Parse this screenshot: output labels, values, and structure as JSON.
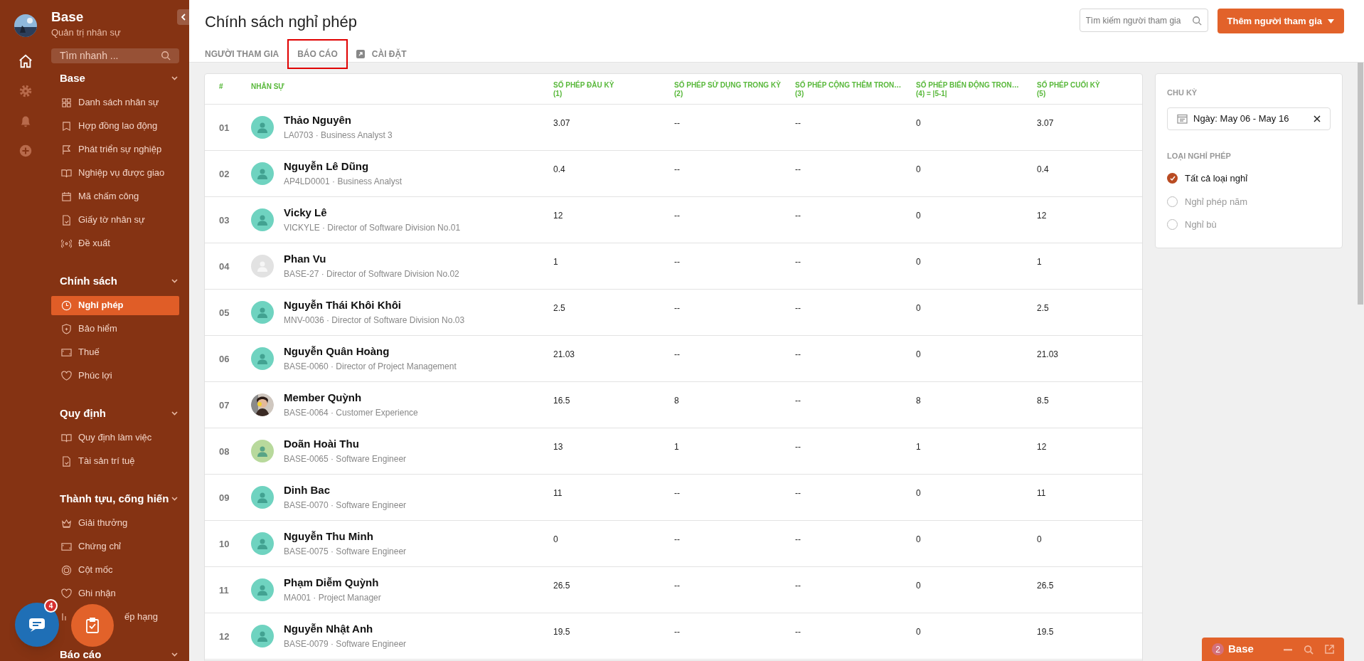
{
  "app": {
    "title": "Base",
    "subtitle": "Quản trị nhân sự",
    "search_placeholder": "Tìm nhanh ..."
  },
  "rail": [
    {
      "selected": true
    },
    {
      "selected": false
    },
    {
      "selected": false
    },
    {
      "selected": false
    }
  ],
  "sidebar": [
    {
      "heading": "Base",
      "items": [
        {
          "label": "Danh sách nhân sự",
          "selected": false
        },
        {
          "label": "Hợp đồng lao động",
          "selected": false
        },
        {
          "label": "Phát triển sự nghiệp",
          "selected": false
        },
        {
          "label": "Nghiệp vụ được giao",
          "selected": false
        },
        {
          "label": "Mã chấm công",
          "selected": false
        },
        {
          "label": "Giấy tờ nhân sự",
          "selected": false
        },
        {
          "label": "Đề xuất",
          "selected": false
        }
      ]
    },
    {
      "heading": "Chính sách",
      "items": [
        {
          "label": "Nghỉ phép",
          "selected": true
        },
        {
          "label": "Bảo hiểm",
          "selected": false
        },
        {
          "label": "Thuế",
          "selected": false
        },
        {
          "label": "Phúc lợi",
          "selected": false
        }
      ]
    },
    {
      "heading": "Quy định",
      "items": [
        {
          "label": "Quy định làm việc",
          "selected": false
        },
        {
          "label": "Tài sản trí tuệ",
          "selected": false
        }
      ]
    },
    {
      "heading": "Thành tựu, cống hiến",
      "items": [
        {
          "label": "Giải thưởng",
          "selected": false
        },
        {
          "label": "Chứng chỉ",
          "selected": false
        },
        {
          "label": "Cột mốc",
          "selected": false
        },
        {
          "label": "Ghi nhận",
          "selected": false
        },
        {
          "label": "ếp hạng",
          "selected": false,
          "kind": "partly_hidden"
        }
      ]
    },
    {
      "heading": "Báo cáo"
    }
  ],
  "chat_badge": "4",
  "page": {
    "title": "Chính sách nghỉ phép",
    "tabs": [
      {
        "label": "NGƯỜI THAM GIA",
        "highlighted": false,
        "icon": false
      },
      {
        "label": "BÁO CÁO",
        "highlighted": true,
        "icon": false
      },
      {
        "label": "CÀI ĐẶT",
        "highlighted": false,
        "icon": true
      }
    ],
    "search_placeholder": "Tìm kiếm người tham gia",
    "add_button": "Thêm người tham gia"
  },
  "table": {
    "columns": [
      {
        "label": "#"
      },
      {
        "label": "NHÂN SỰ"
      },
      {
        "label": "SỐ PHÉP ĐẦU KỲ",
        "sub": "(1)"
      },
      {
        "label": "SỐ PHÉP SỬ DỤNG TRONG KỲ",
        "sub": "(2)"
      },
      {
        "label": "SỐ PHÉP CỘNG THÊM TRON…",
        "sub": "(3)"
      },
      {
        "label": "SỐ PHÉP BIẾN ĐỘNG TRON…",
        "sub": "(4) = |5-1|"
      },
      {
        "label": "SỐ PHÉP CUỐI KỲ",
        "sub": "(5)"
      }
    ],
    "rows": [
      {
        "index": "01",
        "name": "Thảo Nguyên",
        "meta": "LA0703 · Business Analyst 3",
        "avatar": {
          "kind": "icon",
          "color": "#6fd3c0"
        },
        "values": [
          "3.07",
          "--",
          "--",
          "0",
          "3.07"
        ]
      },
      {
        "index": "02",
        "name": "Nguyễn Lê Dũng",
        "meta": "AP4LD0001 · Business Analyst",
        "avatar": {
          "kind": "icon",
          "color": "#6fd3c0"
        },
        "values": [
          "0.4",
          "--",
          "--",
          "0",
          "0.4"
        ]
      },
      {
        "index": "03",
        "name": "Vicky Lê",
        "meta": "VICKYLE · Director of Software Division No.01",
        "avatar": {
          "kind": "icon",
          "color": "#6fd3c0"
        },
        "values": [
          "12",
          "--",
          "--",
          "0",
          "12"
        ]
      },
      {
        "index": "04",
        "name": "Phan Vu",
        "meta": "BASE-27 · Director of Software Division No.02",
        "avatar": {
          "kind": "icon",
          "color": "#e2e2e2"
        },
        "values": [
          "1",
          "--",
          "--",
          "0",
          "1"
        ]
      },
      {
        "index": "05",
        "name": "Nguyễn Thái Khôi Khôi",
        "meta": "MNV-0036 · Director of Software Division No.03",
        "avatar": {
          "kind": "icon",
          "color": "#6fd3c0"
        },
        "values": [
          "2.5",
          "--",
          "--",
          "0",
          "2.5"
        ]
      },
      {
        "index": "06",
        "name": "Nguyễn Quân Hoàng",
        "meta": "BASE-0060 · Director of Project Management",
        "avatar": {
          "kind": "icon",
          "color": "#6fd3c0"
        },
        "values": [
          "21.03",
          "--",
          "--",
          "0",
          "21.03"
        ]
      },
      {
        "index": "07",
        "name": "Member Quỳnh",
        "meta": "BASE-0064 · Customer Experience",
        "values": [
          "16.5",
          "8",
          "--",
          "8",
          "8.5"
        ]
      },
      {
        "index": "08",
        "name": "Doãn Hoài Thu",
        "meta": "BASE-0065 · Software Engineer",
        "avatar": {
          "kind": "icon",
          "color": "#b8d99c"
        },
        "values": [
          "13",
          "1",
          "--",
          "1",
          "12"
        ]
      },
      {
        "index": "09",
        "name": "Dinh Bac",
        "meta": "BASE-0070 · Software Engineer",
        "avatar": {
          "kind": "icon",
          "color": "#6fd3c0"
        },
        "values": [
          "11",
          "--",
          "--",
          "0",
          "11"
        ]
      },
      {
        "index": "10",
        "name": "Nguyễn Thu Minh",
        "meta": "BASE-0075 · Software Engineer",
        "avatar": {
          "kind": "icon",
          "color": "#6fd3c0"
        },
        "values": [
          "0",
          "--",
          "--",
          "0",
          "0"
        ]
      },
      {
        "index": "11",
        "name": "Phạm Diễm Quỳnh",
        "meta": "MA001 · Project Manager",
        "avatar": {
          "kind": "icon",
          "color": "#6fd3c0"
        },
        "values": [
          "26.5",
          "--",
          "--",
          "0",
          "26.5"
        ]
      },
      {
        "index": "12",
        "name": "Nguyễn Nhật Anh",
        "meta": "BASE-0079 · Software Engineer",
        "avatar": {
          "kind": "icon",
          "color": "#6fd3c0"
        },
        "values": [
          "19.5",
          "--",
          "--",
          "0",
          "19.5"
        ]
      }
    ]
  },
  "filters": {
    "period_label": "CHU KỲ",
    "period_value": "Ngày: May 06 - May 16",
    "type_label": "LOẠI NGHỈ PHÉP",
    "types": [
      {
        "label": "Tất cả loại nghỉ",
        "selected": true
      },
      {
        "label": "Nghỉ phép năm",
        "selected": false
      },
      {
        "label": "Nghỉ bù",
        "selected": false
      }
    ]
  },
  "chat_bar": {
    "count": "2",
    "title": "Base"
  }
}
